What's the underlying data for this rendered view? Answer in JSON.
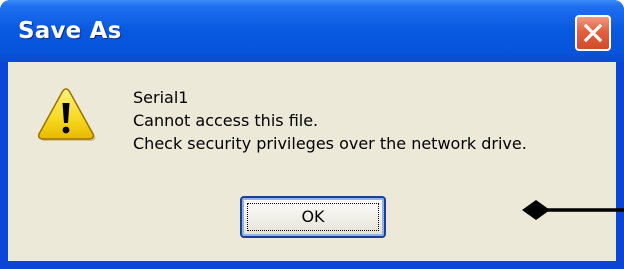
{
  "window": {
    "title": "Save As"
  },
  "message": {
    "line1": "Serial1",
    "line2": "Cannot access this file.",
    "line3": "Check security privileges over the network drive."
  },
  "buttons": {
    "ok_label": "OK"
  },
  "icons": {
    "warning": "warning-icon",
    "close": "close-icon",
    "annotation": "arrow-pointer-icon"
  },
  "colors": {
    "titlebar": "#0858e0",
    "client_bg": "#ece9d8",
    "close_button": "#e26040",
    "warning_yellow": "#f8d820"
  }
}
